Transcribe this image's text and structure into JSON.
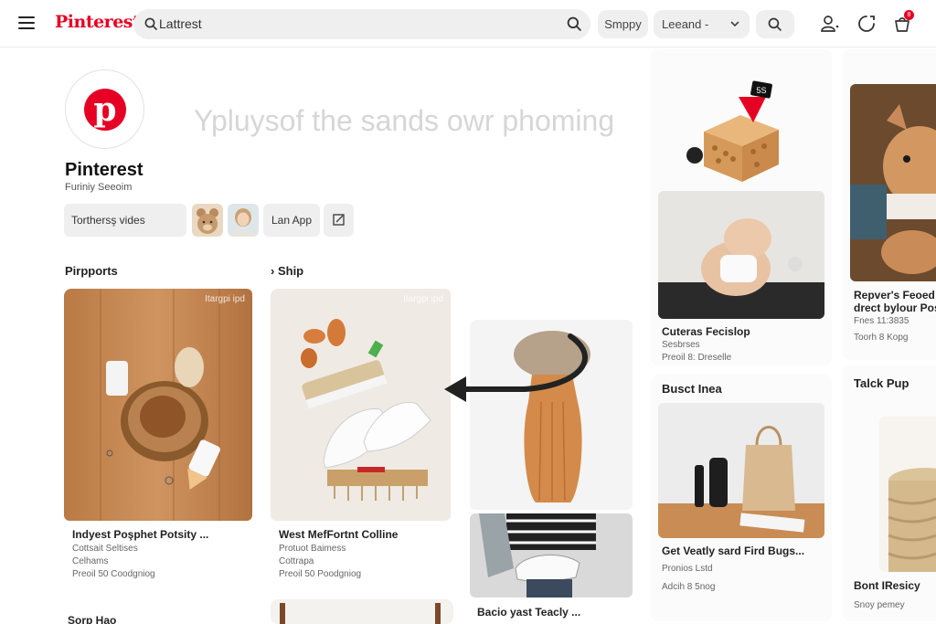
{
  "header": {
    "logo": "Pinterest",
    "search_value": "Lattrest",
    "shop_label": "Smppy",
    "lang_label": "Leeand -",
    "notification_count": "8"
  },
  "profile": {
    "name": "Pinterest",
    "subtitle": "Furiniy Seeoim",
    "tagline": "Ypluysof the sands owr phoming",
    "chip_videos": "Torthersş vides",
    "chip_app": "Lan App"
  },
  "sections": {
    "left": "Pirpports",
    "mid": "Ship"
  },
  "pins": [
    {
      "title": "Indyest Poşphet Potsity ...",
      "meta1": "Cottsait Seltises",
      "meta2": "Celhams",
      "meta3": "Preoil 50 Coodgniog",
      "watermark": "Itargpi ipd"
    },
    {
      "title": "West MefFortnt Colline",
      "meta1": "Protuot Baimess",
      "meta2": "Cottrapa",
      "meta3": "Preoil 50 Poodgniog",
      "watermark": "Itargpi ipd"
    },
    {
      "title": "Bacio yast Teacly ..."
    },
    {
      "title": "Cuteras Fecislop",
      "meta1": "Sesbrses",
      "meta2": "Preoil 8: Dreselle",
      "tag": "5S"
    },
    {
      "title": "Repver's Feoed I...",
      "title2": "drect bylour Post",
      "meta1": "Fnes 11:3835",
      "meta2": "Toorh 8 Kopg"
    },
    {
      "title": "Busct Inea"
    },
    {
      "title": "Get Veatly sard Fird Bugs...",
      "meta1": "Pronios Lstd",
      "meta2": "Adcih 8 5nog"
    },
    {
      "title": "Talck Pup"
    },
    {
      "title": "Bont IResicy",
      "meta1": "Snoy pemey"
    },
    {
      "title": "Sorp Hao"
    }
  ]
}
